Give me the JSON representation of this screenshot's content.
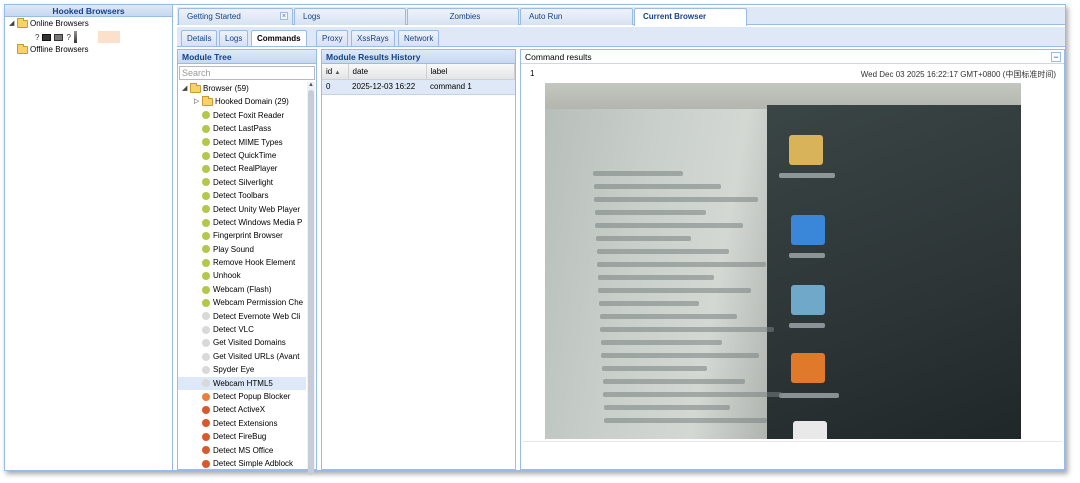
{
  "hooked": {
    "title": "Hooked Browsers",
    "online": "Online Browsers",
    "offline": "Offline Browsers",
    "browser_entry_icons": [
      "question-icon",
      "os-icon",
      "hardware-icon",
      "question-icon"
    ]
  },
  "top_tabs": [
    {
      "label": "Getting Started",
      "closable": true
    },
    {
      "label": "Logs"
    },
    {
      "label": "Zombies"
    },
    {
      "label": "Auto Run"
    },
    {
      "label": "Current Browser",
      "active": true
    }
  ],
  "sub_tabs": [
    {
      "label": "Details"
    },
    {
      "label": "Logs"
    },
    {
      "label": "Commands",
      "active": true
    },
    {
      "label": "Proxy"
    },
    {
      "label": "XssRays"
    },
    {
      "label": "Network"
    }
  ],
  "module_tree": {
    "title": "Module Tree",
    "search_placeholder": "Search",
    "root": "Browser (59)",
    "folder": "Hooked Domain (29)",
    "items": [
      {
        "label": "Detect Foxit Reader",
        "status": "#b3c84a"
      },
      {
        "label": "Detect LastPass",
        "status": "#b3c84a"
      },
      {
        "label": "Detect MIME Types",
        "status": "#b3c84a"
      },
      {
        "label": "Detect QuickTime",
        "status": "#b3c84a"
      },
      {
        "label": "Detect RealPlayer",
        "status": "#b3c84a"
      },
      {
        "label": "Detect Silverlight",
        "status": "#b3c84a"
      },
      {
        "label": "Detect Toolbars",
        "status": "#b3c84a"
      },
      {
        "label": "Detect Unity Web Player",
        "status": "#b3c84a"
      },
      {
        "label": "Detect Windows Media P",
        "status": "#b3c84a"
      },
      {
        "label": "Fingerprint Browser",
        "status": "#b3c84a"
      },
      {
        "label": "Play Sound",
        "status": "#b3c84a"
      },
      {
        "label": "Remove Hook Element",
        "status": "#b3c84a"
      },
      {
        "label": "Unhook",
        "status": "#b3c84a"
      },
      {
        "label": "Webcam (Flash)",
        "status": "#b3c84a"
      },
      {
        "label": "Webcam Permission Che",
        "status": "#b3c84a"
      },
      {
        "label": "Detect Evernote Web Cli",
        "status": "#d9d9d9"
      },
      {
        "label": "Detect VLC",
        "status": "#d9d9d9"
      },
      {
        "label": "Get Visited Domains",
        "status": "#d9d9d9"
      },
      {
        "label": "Get Visited URLs (Avant",
        "status": "#d9d9d9"
      },
      {
        "label": "Spyder Eye",
        "status": "#d9d9d9"
      },
      {
        "label": "Webcam HTML5",
        "status": "#d9d9d9",
        "selected": true
      },
      {
        "label": "Detect Popup Blocker",
        "status": "#e8803c"
      },
      {
        "label": "Detect ActiveX",
        "status": "#d65a2e"
      },
      {
        "label": "Detect Extensions",
        "status": "#d65a2e"
      },
      {
        "label": "Detect FireBug",
        "status": "#d65a2e"
      },
      {
        "label": "Detect MS Office",
        "status": "#d65a2e"
      },
      {
        "label": "Detect Simple Adblock",
        "status": "#d65a2e"
      }
    ]
  },
  "history": {
    "title": "Module Results History",
    "columns": [
      "id",
      "date",
      "label"
    ],
    "rows": [
      {
        "id": "0",
        "date": "2025-12-03 16:22",
        "label": "command 1"
      }
    ]
  },
  "results": {
    "title": "Command results",
    "index": "1",
    "timestamp": "Wed Dec 03 2025 16:22:17 GMT+0800 (中国标准时间)"
  },
  "colors": {
    "panel_border": "#99bbe8",
    "header_text": "#15428b",
    "selection": "#dde8f8"
  }
}
